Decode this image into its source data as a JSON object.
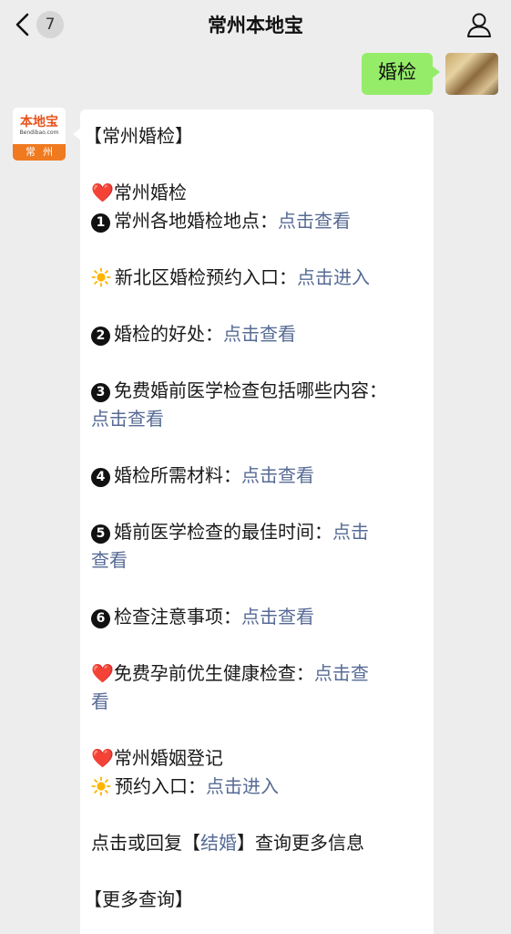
{
  "navbar": {
    "title": "常州本地宝",
    "unread_count": "7",
    "back_icon": "chevron-left-icon",
    "profile_icon": "person-icon"
  },
  "sent_message": {
    "text": "婚检"
  },
  "bot": {
    "logo_text": "本地宝",
    "logo_domain": "Bendibao.com",
    "logo_city": "常州"
  },
  "message": {
    "header": "【常州婚检】",
    "section1_title": "常州婚检",
    "items": [
      {
        "num": "❶",
        "label": "常州各地婚检地点：",
        "link": "点击查看"
      },
      {
        "num": "☀",
        "label": "新北区婚检预约入口：",
        "link": "点击进入"
      },
      {
        "num": "❷",
        "label": "婚检的好处：",
        "link": "点击查看"
      },
      {
        "num": "❸",
        "label": "免费婚前医学检查包括哪些内容：",
        "link": "点击查看"
      },
      {
        "num": "❹",
        "label": "婚检所需材料：",
        "link": "点击查看"
      },
      {
        "num": "❺",
        "label": "婚前医学检查的最佳时间：",
        "link_part1": "点击",
        "link_part2": "查看"
      },
      {
        "num": "❻",
        "label": "检查注意事项：",
        "link": "点击查看"
      }
    ],
    "free_check": {
      "label": "免费孕前优生健康检查：",
      "link_part1": "点击查",
      "link_part2": "看"
    },
    "section2_title": "常州婚姻登记",
    "reservation": {
      "label": "预约入口：",
      "link": "点击进入"
    },
    "reply_hint": {
      "prefix": "点击或回复【",
      "keyword": "结婚",
      "suffix": "】查询更多信息"
    },
    "footer": "【更多查询】"
  },
  "colors": {
    "background": "#ededed",
    "sent_bubble": "#95ec69",
    "link": "#576b95",
    "heart": "#e0202a",
    "brand_orange": "#f07a20"
  }
}
